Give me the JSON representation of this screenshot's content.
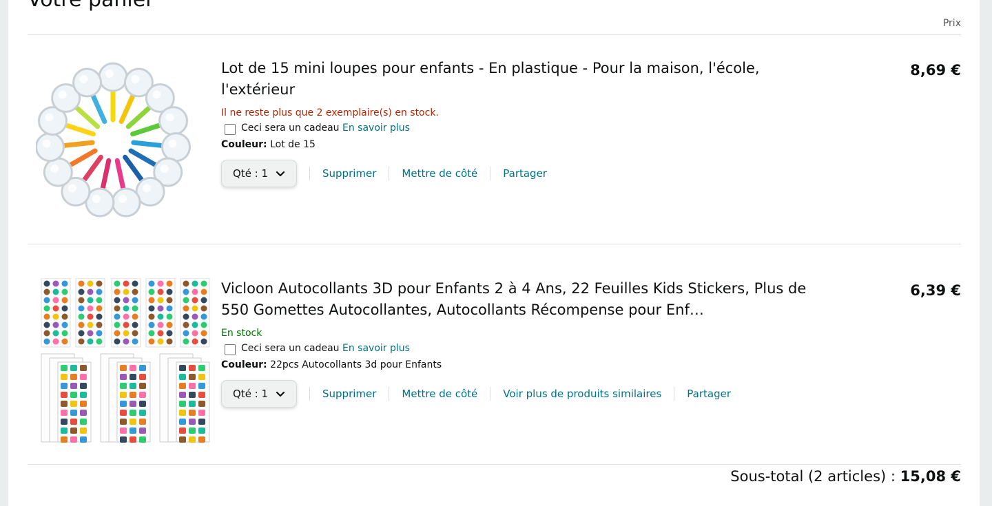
{
  "cart": {
    "title": "Votre panier",
    "price_header": "Prix",
    "items": [
      {
        "name": "Lot de 15 mini loupes pour enfants - En plastique - Pour la maison, l'école, l'extérieur",
        "stock": "Il ne reste plus que 2 exemplaire(s) en stock.",
        "gift_label": "Ceci sera un cadeau",
        "gift_link": "En savoir plus",
        "attr_label": "Couleur:",
        "attr_value": "Lot de 15",
        "qty_label": "Qté :",
        "qty_value": "1",
        "actions": [
          "Supprimer",
          "Mettre de côté",
          "Partager"
        ],
        "price": "8,69 €",
        "image_icon": "magnifying-glasses-product-image"
      },
      {
        "name": "Vicloon Autocollants 3D pour Enfants 2 à 4 Ans, 22 Feuilles Kids Stickers, Plus de 550 Gomettes Autocollantes, Autocollants Récompense pour Enf…",
        "stock": "En stock",
        "gift_label": "Ceci sera un cadeau",
        "gift_link": "En savoir plus",
        "attr_label": "Couleur:",
        "attr_value": "22pcs Autocollants 3d pour Enfants",
        "qty_label": "Qté :",
        "qty_value": "1",
        "actions": [
          "Supprimer",
          "Mettre de côté",
          "Voir plus de produits similaires",
          "Partager"
        ],
        "price": "6,39 €",
        "image_icon": "sticker-sheets-product-image"
      }
    ],
    "subtotal_label": "Sous-total (2 articles) :",
    "subtotal_value": "15,08 €"
  },
  "colors": {
    "link": "#007185",
    "low_stock": "#b12704",
    "in_stock": "#007600",
    "text": "#0f1111",
    "background": "#eaeded"
  }
}
